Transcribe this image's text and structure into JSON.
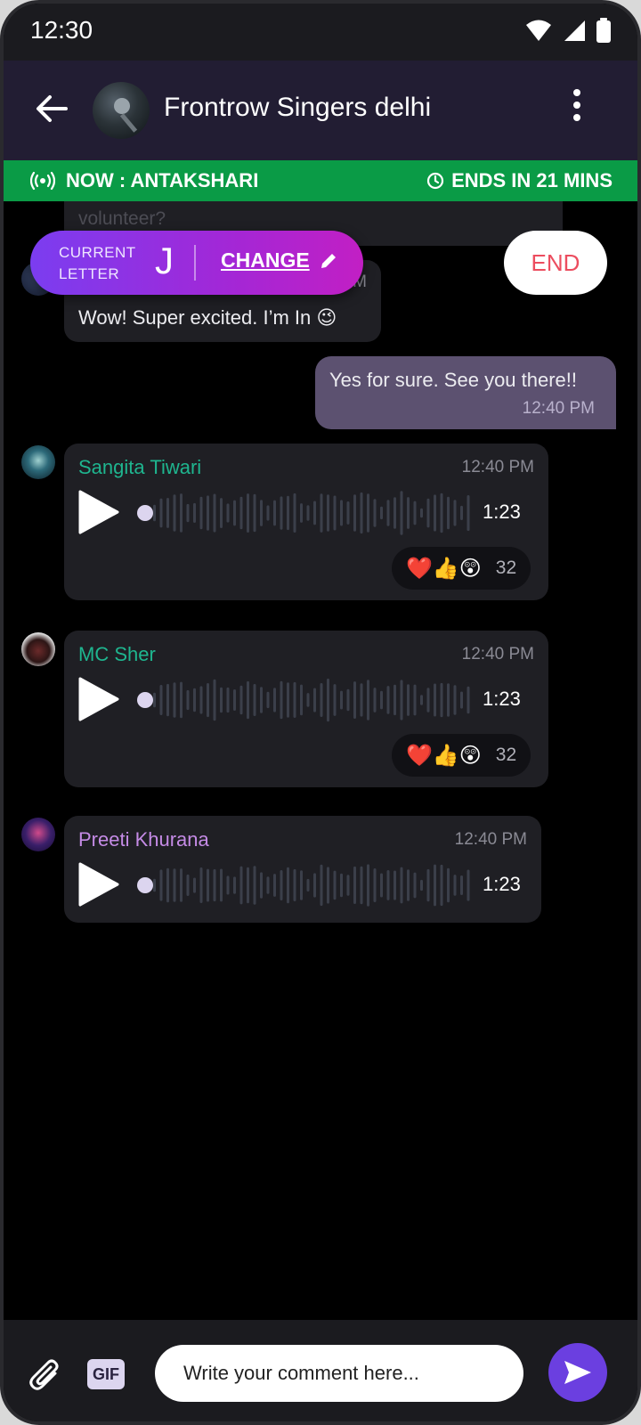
{
  "status_bar": {
    "time": "12:30"
  },
  "header": {
    "title": "Frontrow Singers delhi"
  },
  "banner": {
    "activity": "NOW : ANTAKSHARI",
    "timer": "ENDS IN 21 MINS"
  },
  "game": {
    "current_letter_label_line1": "CURRENT",
    "current_letter_label_line2": "LETTER",
    "current_letter": "J",
    "change_label": "CHANGE",
    "end_label": "END"
  },
  "messages": {
    "partial_text": "volunteer?",
    "partial_time": "M",
    "reply_text": "Wow! Super excited. I’m In 😉",
    "mine_text": "Yes for sure. See you there!!",
    "mine_time": "12:40 PM",
    "voice": [
      {
        "sender": "Sangita Tiwari",
        "sender_color": "#1fb58f",
        "time": "12:40 PM",
        "duration": "1:23",
        "reactions": "❤️👍😲",
        "reaction_count": "32"
      },
      {
        "sender": "MC Sher",
        "sender_color": "#1fb58f",
        "time": "12:40 PM",
        "duration": "1:23",
        "reactions": "❤️👍😲",
        "reaction_count": "32"
      },
      {
        "sender": "Preeti Khurana",
        "sender_color": "#c58be6",
        "time": "12:40 PM",
        "duration": "1:23"
      }
    ]
  },
  "composer": {
    "placeholder": "Write your comment here...",
    "gif_label": "GIF"
  },
  "colors": {
    "header_bg": "#221d33",
    "banner_bg": "#0a9b46",
    "accent": "#6b3fe0",
    "end_red": "#ec4d5f"
  }
}
